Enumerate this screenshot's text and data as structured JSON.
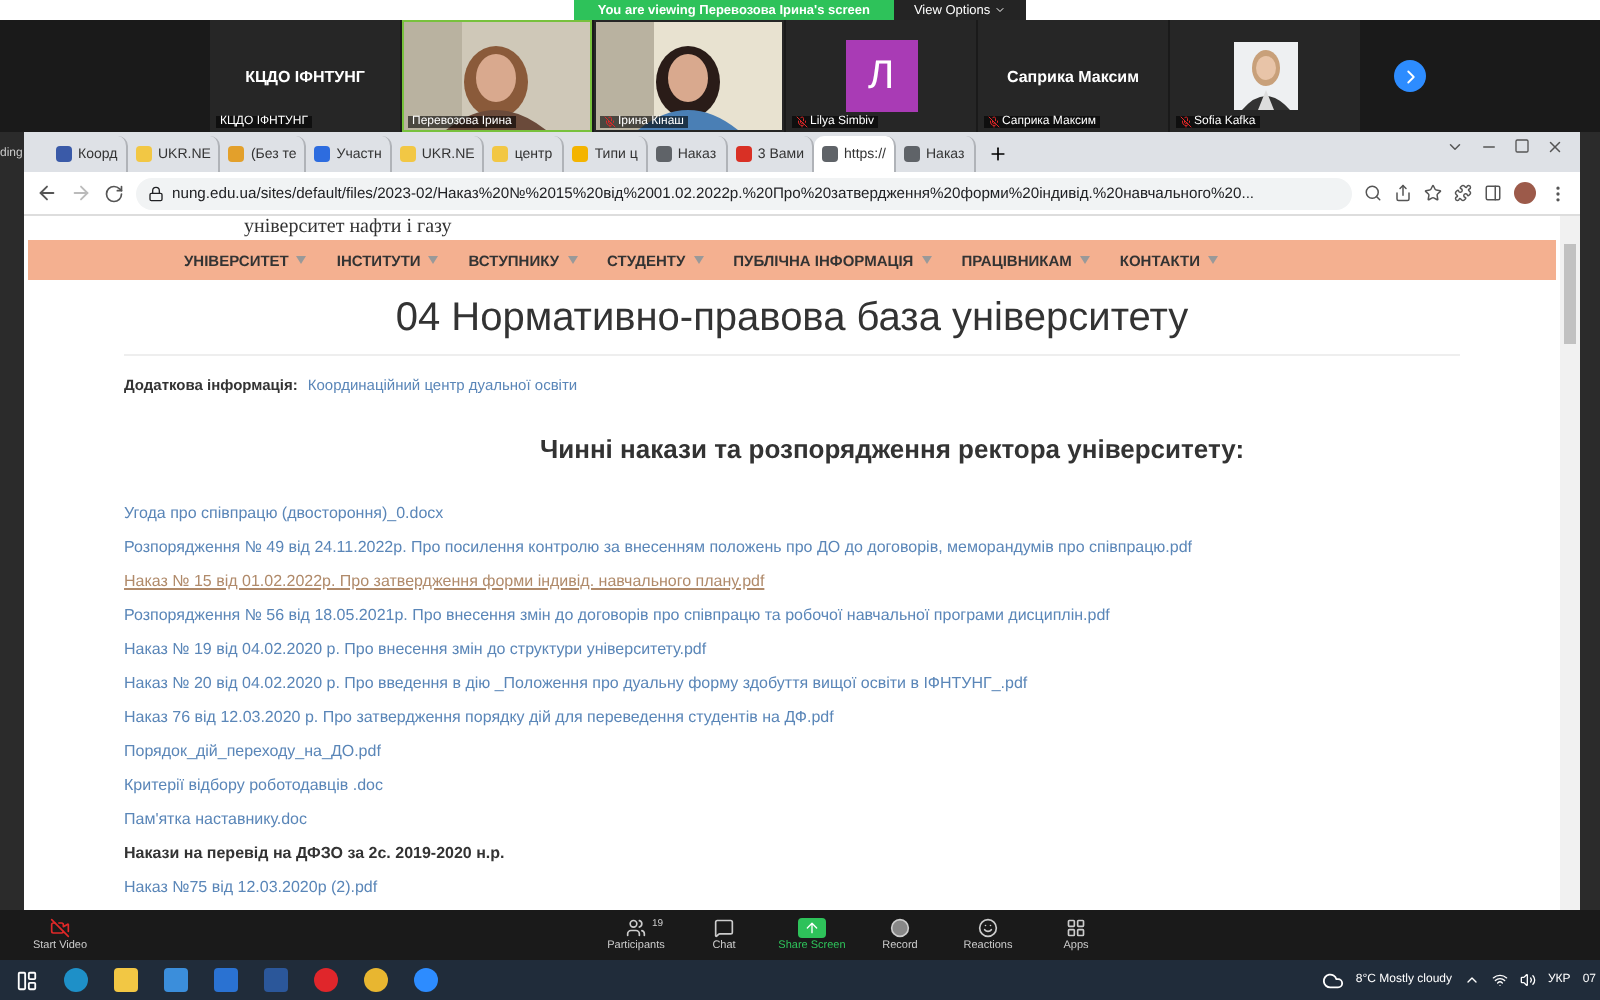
{
  "zoom_banner": {
    "text": "You are viewing Перевозова Ірина's screen",
    "view_options": "View Options"
  },
  "gallery": [
    {
      "kind": "name",
      "name": "КЦДО ІФНТУНГ",
      "label": "КЦДО ІФНТУНГ",
      "muted": false,
      "speaking": false
    },
    {
      "kind": "video",
      "label": "Перевозова Ірина",
      "muted": false,
      "speaking": true
    },
    {
      "kind": "video",
      "label": "Ірина Кінаш",
      "muted": true,
      "speaking": false
    },
    {
      "kind": "avatar",
      "letter": "Л",
      "color": "#a93bb5",
      "label": "Lilya Simbiv",
      "muted": true,
      "speaking": false
    },
    {
      "kind": "name",
      "name": "Саприка Максим",
      "label": "Саприка Максим",
      "muted": true,
      "speaking": false
    },
    {
      "label": "Sofia Kafka",
      "muted": true,
      "speaking": false
    }
  ],
  "side_text": "ding",
  "browser": {
    "tabs": [
      {
        "label": "Коорд",
        "color": "#3a5aa8",
        "selected": false
      },
      {
        "label": "UKR.NE",
        "color": "#f2c744",
        "selected": false
      },
      {
        "label": "(Без те",
        "color": "#e3a02b",
        "selected": false
      },
      {
        "label": "Участн",
        "color": "#2d6cdf",
        "selected": false
      },
      {
        "label": "UKR.NE",
        "color": "#f2c744",
        "selected": false
      },
      {
        "label": "центр",
        "color": "#f2c744",
        "selected": false
      },
      {
        "label": "Типи ц",
        "color": "#f4b400",
        "selected": false
      },
      {
        "label": "Наказ",
        "color": "#5f6368",
        "selected": false
      },
      {
        "label": "3 Вами",
        "color": "#d93025",
        "selected": false
      },
      {
        "label": "https://",
        "color": "#5f6368",
        "selected": true
      },
      {
        "label": "Наказ",
        "color": "#5f6368",
        "selected": false
      }
    ],
    "url": "nung.edu.ua/sites/default/files/2023-02/Наказ%20№%2015%20від%2001.02.2022р.%20Про%20затвердження%20форми%20індивід.%20навчального%20...",
    "page": {
      "site_name": "університет нафти і газу",
      "nav": [
        "УНІВЕРСИТЕТ",
        "ІНСТИТУТИ",
        "ВСТУПНИКУ",
        "СТУДЕНТУ",
        "ПУБЛІЧНА ІНФОРМАЦІЯ",
        "ПРАЦІВНИКАМ",
        "КОНТАКТИ"
      ],
      "title": "04 Нормативно-правова база університету",
      "extra_label": "Додаткова інформація:",
      "extra_link": "Координаційний центр дуальної освіти",
      "section_title": "Чинні накази та розпорядження ректора університету:",
      "items": [
        {
          "kind": "link",
          "text": "Угода про співпрацю (двостороння)_0.docx",
          "visited": false
        },
        {
          "kind": "link",
          "text": "Розпорядження № 49 від 24.11.2022р. Про посилення контролю за внесенням положень про ДО до договорів, меморандумів про співпрацю.pdf",
          "visited": false
        },
        {
          "kind": "link",
          "text": "Наказ № 15 від 01.02.2022р. Про затвердження форми індивід. навчального плану.pdf",
          "visited": true
        },
        {
          "kind": "link",
          "text": "Розпорядження № 56 від 18.05.2021р. Про внесення змін до договорів про співпрацю та робочої навчальної програми дисциплін.pdf",
          "visited": false
        },
        {
          "kind": "link",
          "text": "Наказ № 19 від 04.02.2020 р. Про внесення змін до структури університету.pdf",
          "visited": false
        },
        {
          "kind": "link",
          "text": "Наказ № 20 від 04.02.2020 р. Про введення в дію _Положення про дуальну форму здобуття вищої освіти в ІФНТУНГ_.pdf",
          "visited": false
        },
        {
          "kind": "link",
          "text": "Наказ 76 від 12.03.2020 р. Про затвердження порядку дій для переведення студентів на ДФ.pdf",
          "visited": false
        },
        {
          "kind": "link",
          "text": "Порядок_дій_переходу_на_ДО.pdf",
          "visited": false
        },
        {
          "kind": "link",
          "text": "Критерії відбору роботодавців .doc",
          "visited": false
        },
        {
          "kind": "link",
          "text": "Пам'ятка наставнику.doc",
          "visited": false
        },
        {
          "kind": "heading",
          "text": "Накази на перевід на ДФЗО за 2с. 2019-2020 н.р."
        },
        {
          "kind": "link",
          "text": "Наказ №75 від 12.03.2020р (2).pdf",
          "visited": false
        }
      ]
    }
  },
  "toolbar": {
    "start_video": "Start Video",
    "buttons": [
      {
        "kind": "participants",
        "label": "Participants",
        "count": "19"
      },
      {
        "kind": "chat",
        "label": "Chat"
      },
      {
        "kind": "share",
        "label": "Share Screen"
      },
      {
        "kind": "record",
        "label": "Record"
      },
      {
        "kind": "reactions",
        "label": "Reactions"
      },
      {
        "kind": "apps",
        "label": "Apps"
      }
    ]
  },
  "taskbar": {
    "weather": "8°C  Mostly cloudy",
    "language": "УКР",
    "clock": "07"
  }
}
